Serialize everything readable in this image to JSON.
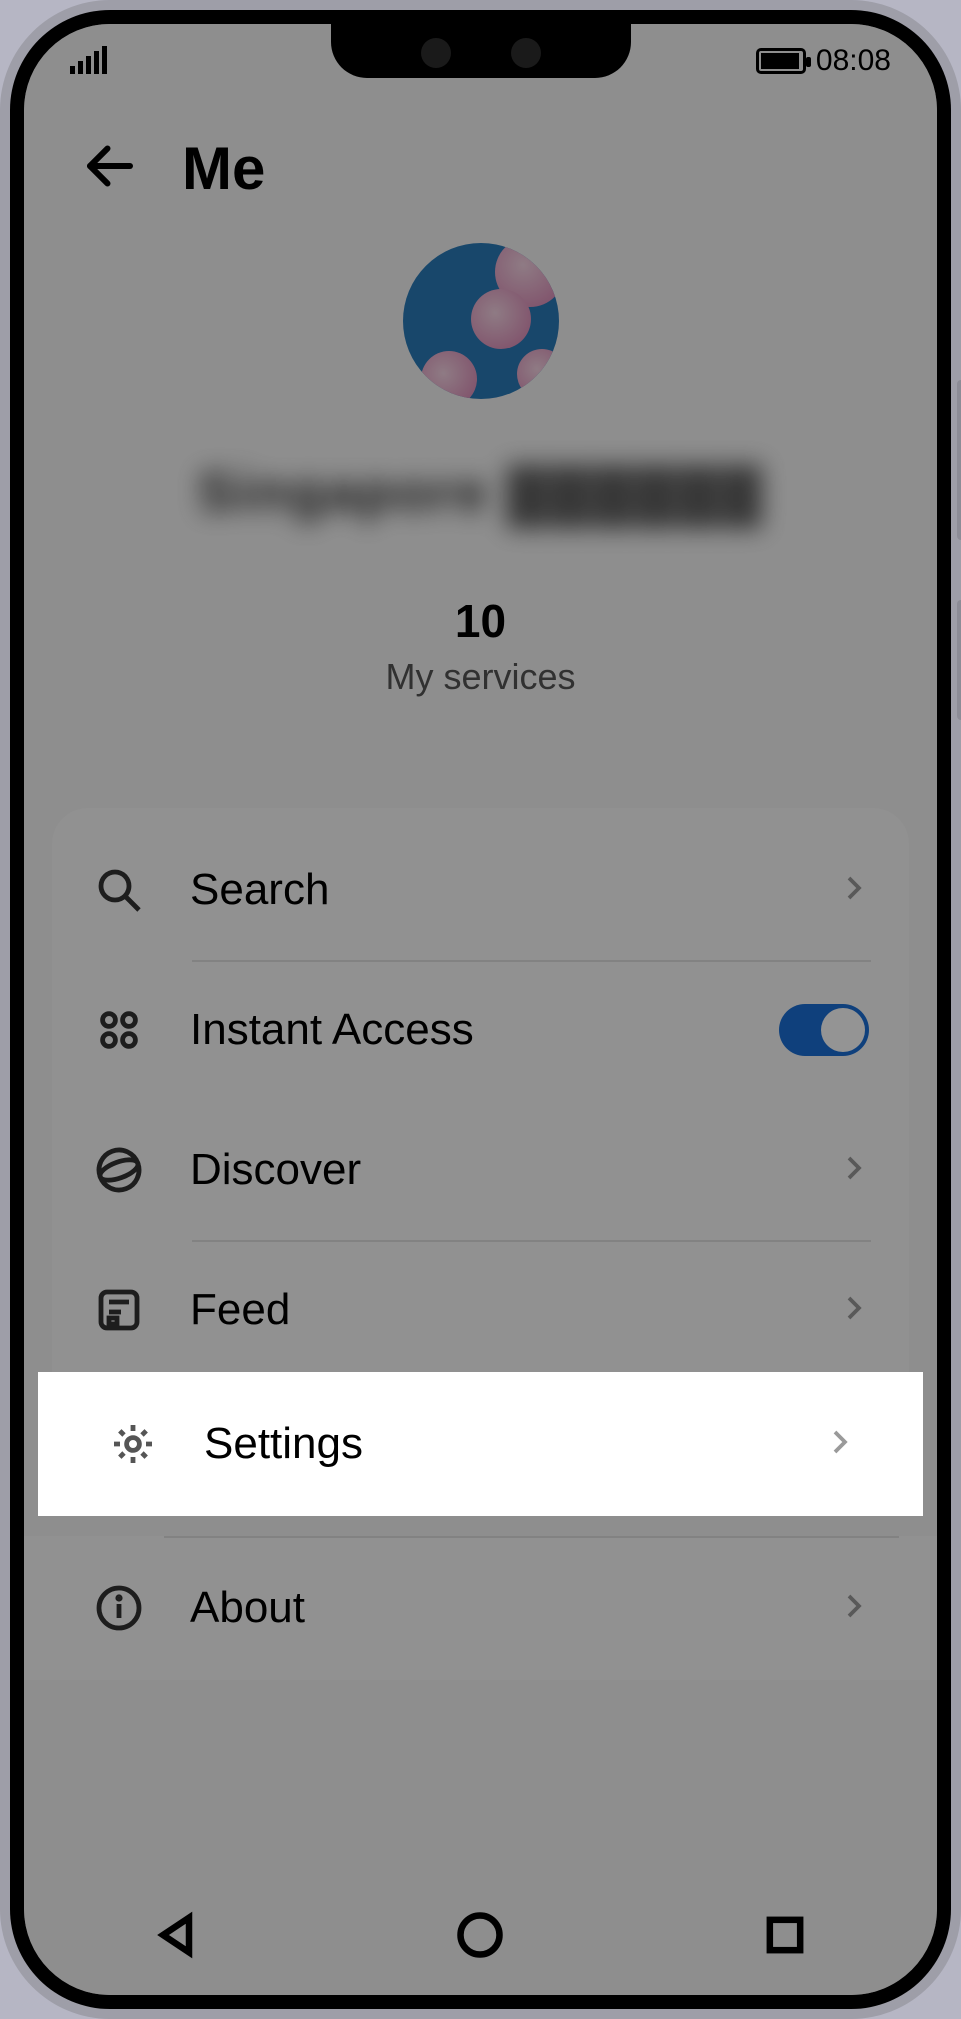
{
  "statusbar": {
    "time": "08:08"
  },
  "header": {
    "title": "Me"
  },
  "profile": {
    "username": "Singapore ▓▓▓▓▓▓",
    "services_count": "10",
    "services_label": "My services"
  },
  "menu": {
    "search": {
      "label": "Search",
      "icon": "search-icon",
      "has_chevron": true
    },
    "instant_access": {
      "label": "Instant Access",
      "icon": "grid-icon",
      "toggle_on": true
    },
    "discover": {
      "label": "Discover",
      "icon": "globe-icon",
      "has_chevron": true
    },
    "feed": {
      "label": "Feed",
      "icon": "feed-icon",
      "has_chevron": true
    }
  },
  "bottom": {
    "settings": {
      "label": "Settings",
      "icon": "gear-icon",
      "has_chevron": true
    },
    "about": {
      "label": "About",
      "icon": "info-icon",
      "has_chevron": true
    }
  }
}
